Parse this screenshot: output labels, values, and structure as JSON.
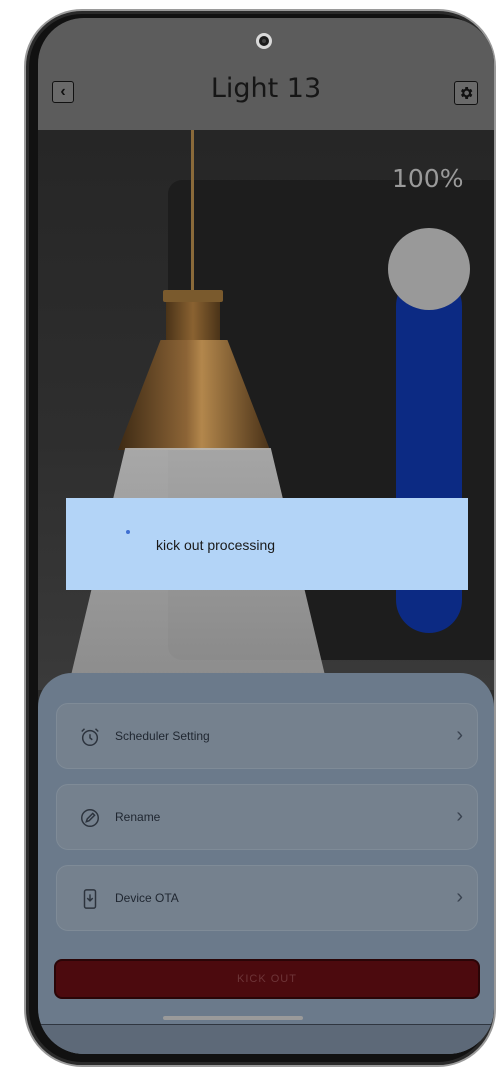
{
  "header": {
    "title": "Light 13",
    "back_icon": "chevron-left-icon",
    "settings_icon": "gear-icon"
  },
  "brightness": {
    "label": "100%",
    "level_percent": 100
  },
  "toast": {
    "message": "kick out processing"
  },
  "menu": {
    "items": [
      {
        "label": "Scheduler Setting",
        "icon": "alarm-clock-icon"
      },
      {
        "label": "Rename",
        "icon": "pencil-icon"
      },
      {
        "label": "Device OTA",
        "icon": "download-icon"
      }
    ]
  },
  "actions": {
    "kick_out_label": "KICK OUT"
  },
  "colors": {
    "slider_track": "#0c2a83",
    "toast_bg": "#b3d4f7",
    "kick_button_bg": "#4c0a0e"
  }
}
